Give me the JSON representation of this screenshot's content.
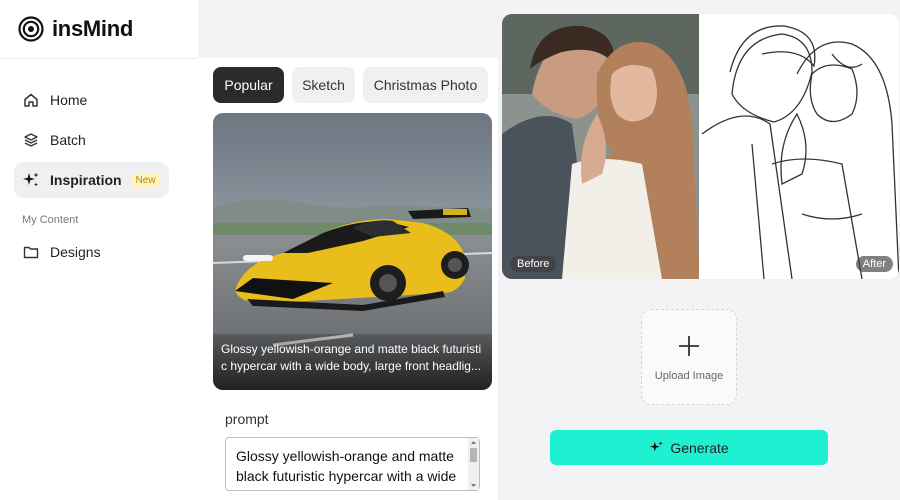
{
  "app": {
    "name": "insMind"
  },
  "sidebar": {
    "items": [
      {
        "label": "Home",
        "icon": "home-icon"
      },
      {
        "label": "Batch",
        "icon": "layers-icon"
      },
      {
        "label": "Inspiration",
        "icon": "sparkle-icon",
        "badge": "New",
        "active": true
      }
    ],
    "section_label": "My Content",
    "content_items": [
      {
        "label": "Designs",
        "icon": "folder-icon"
      }
    ]
  },
  "tabs": [
    {
      "label": "Popular",
      "active": true
    },
    {
      "label": "Sketch"
    },
    {
      "label": "Christmas Photo"
    }
  ],
  "card": {
    "caption": "Glossy yellowish-orange and matte black futuristi c hypercar with a wide body, large front headlig..."
  },
  "prompt": {
    "label": "prompt",
    "value": "Glossy yellowish-orange and matte black futuristic hypercar with a wide body, large front headlights"
  },
  "preview": {
    "before_label": "Before",
    "after_label": "After"
  },
  "upload": {
    "label": "Upload Image"
  },
  "generate": {
    "label": "Generate"
  },
  "colors": {
    "accent": "#1ef0d2",
    "active_tab": "#2b2b2b",
    "badge_text": "#b58a00",
    "badge_bg": "#fff4c2"
  }
}
